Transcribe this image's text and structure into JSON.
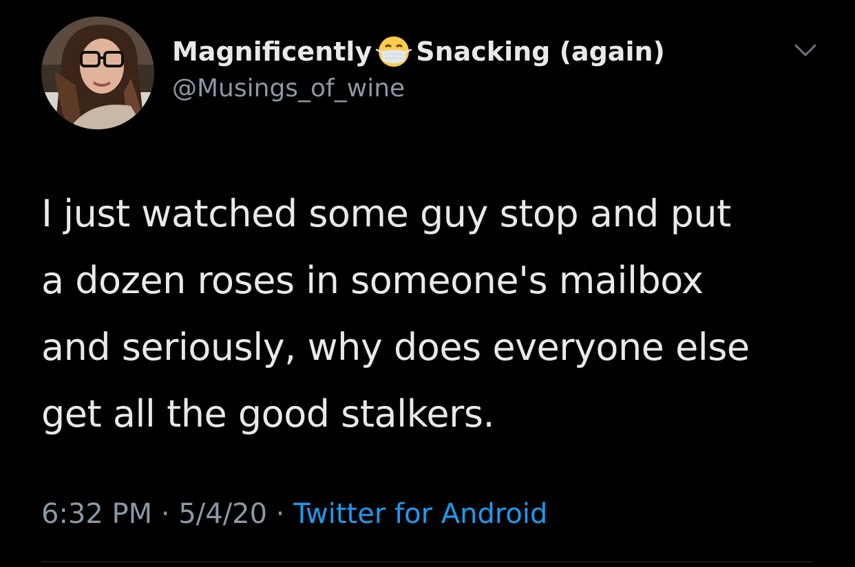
{
  "tweet": {
    "author": {
      "name_part1": "Magnificently",
      "emoji": "face-with-medical-mask",
      "name_part2": "Snacking (again)",
      "handle": "@Musings_of_wine"
    },
    "text_lines": [
      "I just watched some guy stop and put",
      "a dozen roses in someone's mailbox",
      "and seriously, why does everyone else",
      "get all the good stalkers."
    ],
    "time": "6:32 PM",
    "separator": "·",
    "date": "5/4/20",
    "source": "Twitter for Android"
  },
  "colors": {
    "background": "#000000",
    "primary_text": "#e7e9ea",
    "secondary_text": "#8b98a5",
    "link": "#1d9bf0"
  },
  "icons": {
    "menu": "chevron-down-icon"
  }
}
